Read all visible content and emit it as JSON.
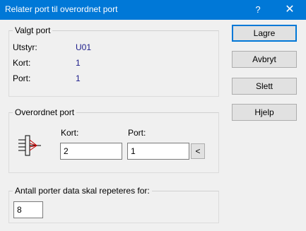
{
  "window": {
    "title": "Relater port til overordnet port",
    "help_label": "?",
    "close_label": "✕"
  },
  "selected_port": {
    "legend": "Valgt port",
    "rows": [
      {
        "label": "Utstyr:",
        "value": "U01"
      },
      {
        "label": "Kort:",
        "value": "1"
      },
      {
        "label": "Port:",
        "value": "1"
      }
    ]
  },
  "parent_port": {
    "legend": "Overordnet port",
    "card_label": "Kort:",
    "card_value": "2",
    "port_label": "Port:",
    "port_value": "1",
    "pick_button_label": "<",
    "icon": "port-connector-icon"
  },
  "repeat": {
    "label": "Antall porter data skal repeteres for:",
    "value": "8"
  },
  "buttons": {
    "save": "Lagre",
    "cancel": "Avbryt",
    "delete": "Slett",
    "help": "Hjelp"
  },
  "colors": {
    "titlebar": "#0078d7",
    "value_text": "#1d1d8a",
    "icon_accent": "#c00000"
  }
}
